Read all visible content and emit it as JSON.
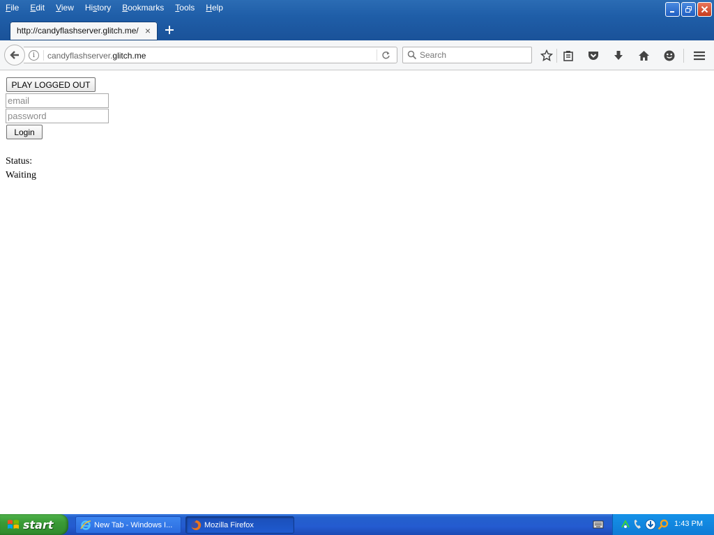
{
  "menu": {
    "items": [
      {
        "u": "F",
        "rest": "ile"
      },
      {
        "u": "E",
        "rest": "dit"
      },
      {
        "u": "V",
        "rest": "iew"
      },
      {
        "pre": "Hi",
        "u": "s",
        "rest": "tory"
      },
      {
        "u": "B",
        "rest": "ookmarks"
      },
      {
        "u": "T",
        "rest": "ools"
      },
      {
        "u": "H",
        "rest": "elp"
      }
    ]
  },
  "tab": {
    "title": "http://candyflashserver.glitch.me/",
    "close": "×"
  },
  "urlbar": {
    "subdomain": "candyflashserver.",
    "domain": "glitch.me"
  },
  "search": {
    "placeholder": "Search"
  },
  "page": {
    "play_label": "PLAY LOGGED OUT",
    "email_placeholder": "email",
    "password_placeholder": "password",
    "login_label": "Login",
    "status_label": "Status:",
    "status_value": "Waiting"
  },
  "taskbar": {
    "start_label": "start",
    "tasks": [
      {
        "label": "New Tab - Windows I...",
        "icon": "ie-icon"
      },
      {
        "label": "Mozilla Firefox",
        "icon": "firefox-icon"
      }
    ],
    "clock": "1:43 PM"
  },
  "colors": {
    "titlebar": "#1f5ea8",
    "taskbar": "#245bd0",
    "start": "#3a9a36",
    "tray": "#0f7bd6"
  }
}
